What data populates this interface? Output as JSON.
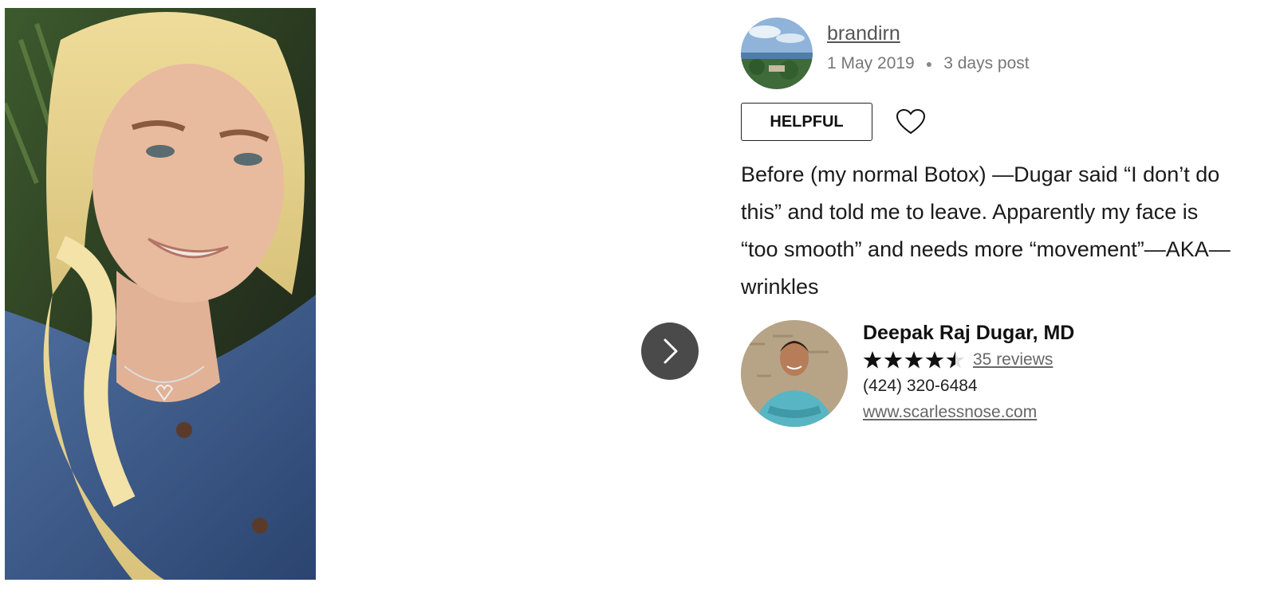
{
  "review": {
    "heading_partial": "",
    "author": "brandirn",
    "date": "1 May 2019",
    "relative_time": "3 days post",
    "helpful_label": "HELPFUL",
    "body_lines": [
      "Before (my normal Botox) —Dugar said “I don’t do",
      "this” and told me to leave. Apparently my face is",
      "“too smooth” and needs more “movement”—AKA—",
      "wrinkles"
    ]
  },
  "doctor": {
    "name": "Deepak Raj Dugar, MD",
    "rating": 4.5,
    "rating_max": 5,
    "reviews_label": "35 reviews",
    "phone": "(424) 320-6484",
    "website": "www.scarlessnose.com"
  },
  "icons": {
    "next": "chevron-right-icon",
    "like": "heart-outline-icon",
    "star": "star-icon"
  },
  "colors": {
    "next_button_bg": "#4a4a4a",
    "link_gray": "#666666",
    "text_dark": "#1a1a1a"
  }
}
